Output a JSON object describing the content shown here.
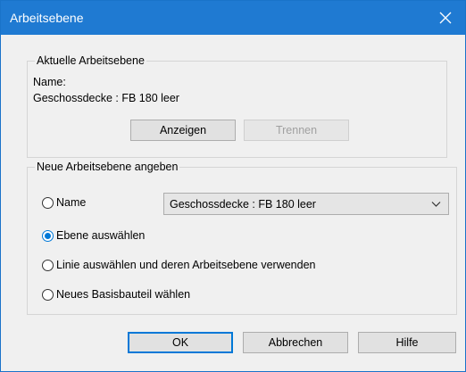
{
  "window": {
    "title": "Arbeitsebene"
  },
  "current": {
    "legend": "Aktuelle Arbeitsebene",
    "name_label": "Name:",
    "name_value": "Geschossdecke : FB 180 leer",
    "show_button": "Anzeigen",
    "detach_button": "Trennen"
  },
  "new_plane": {
    "legend": "Neue Arbeitsebene angeben",
    "options": [
      {
        "label": "Name",
        "checked": false
      },
      {
        "label": "Ebene auswählen",
        "checked": true
      },
      {
        "label": "Linie auswählen und deren Arbeitsebene verwenden",
        "checked": false
      },
      {
        "label": "Neues Basisbauteil wählen",
        "checked": false
      }
    ],
    "name_select_value": "Geschossdecke : FB 180 leer"
  },
  "footer": {
    "ok": "OK",
    "cancel": "Abbrechen",
    "help": "Hilfe"
  },
  "colors": {
    "titlebar": "#1f7ad2",
    "accent": "#0078d7"
  }
}
